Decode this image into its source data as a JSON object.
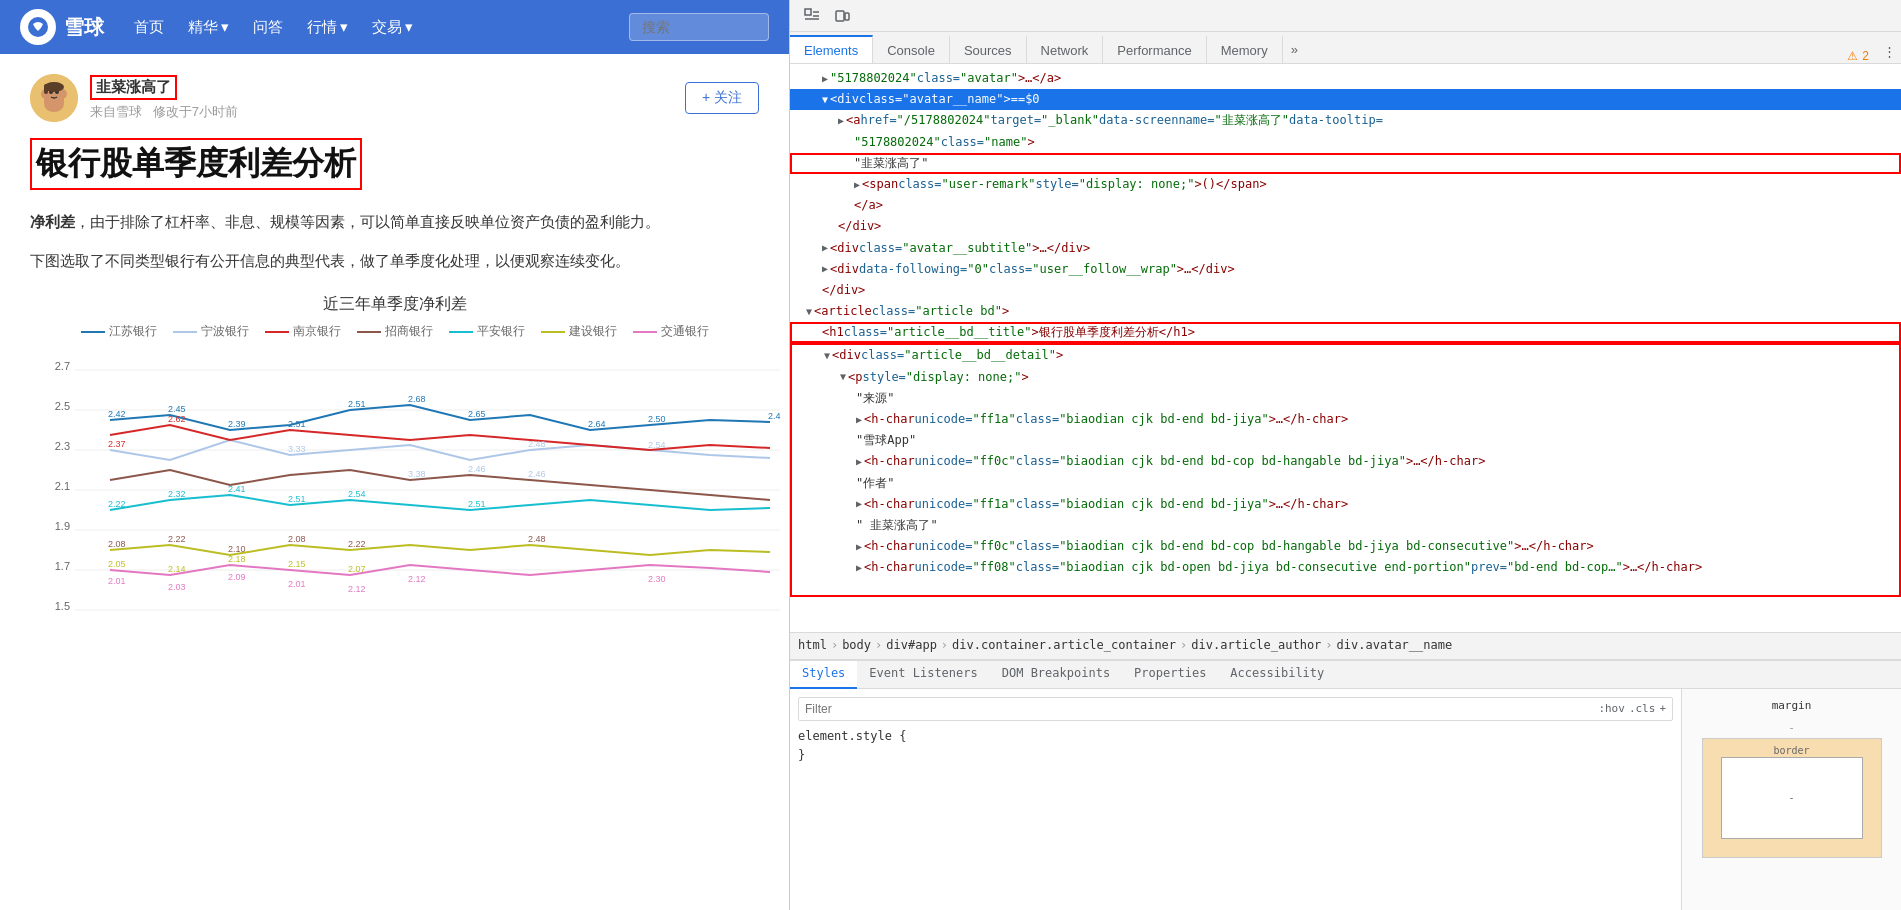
{
  "xueqiu": {
    "header": {
      "logo_text": "雪球",
      "nav_items": [
        "首页",
        "精华",
        "问答",
        "行情",
        "交易"
      ],
      "search_placeholder": "搜索",
      "nav_dropdown": [
        "精华",
        "行情",
        "交易"
      ]
    },
    "article": {
      "author_name": "韭菜涨高了",
      "author_source": "来自雪球",
      "author_time": "修改于7小时前",
      "follow_label": "+ 关注",
      "title": "银行股单季度利差分析",
      "body_p1_bold": "净利差",
      "body_p1_rest": "，由于排除了杠杆率、非息、规模等因素，可以简单直接反映单位资产负债的盈利能力。",
      "body_p2": "下图选取了不同类型银行有公开信息的典型代表，做了单季度化处理，以便观察连续变化。",
      "chart_title": "近三年单季度净利差",
      "chart_legend": [
        {
          "name": "江苏银行",
          "color": "#1f77b4"
        },
        {
          "name": "宁波银行",
          "color": "#aec7e8"
        },
        {
          "name": "南京银行",
          "color": "#d62728"
        },
        {
          "name": "招商银行",
          "color": "#8c564b"
        },
        {
          "name": "平安银行",
          "color": "#17becf"
        },
        {
          "name": "建设银行",
          "color": "#bcbd22"
        },
        {
          "name": "交通银行",
          "color": "#e377c2"
        }
      ]
    }
  },
  "devtools": {
    "toolbar_tabs": [
      "Elements",
      "Console",
      "Sources",
      "Network",
      "Performance",
      "Memory"
    ],
    "tab_active": "Elements",
    "tab_more": "»",
    "warning_count": "2",
    "breadcrumb": [
      "html",
      "body",
      "div#app",
      "div.container.article_container",
      "div.article_author",
      "div.avatar__name"
    ],
    "elements": [
      {
        "indent": 2,
        "content": "\"5178802024\" class=\"avatar\">…</a>",
        "type": "tag_line"
      },
      {
        "indent": 2,
        "content": "▼ <div class=\"avatar__name\"> == $0",
        "type": "tag_open",
        "selected": true
      },
      {
        "indent": 3,
        "content": "▶ <a href=\"/5178802024\" target=\"_blank\" data-screenname=\"韭菜涨高了\" data-tooltip=",
        "type": "tag"
      },
      {
        "indent": 4,
        "content": "\"5178802024\" class=\"name\">",
        "type": "text"
      },
      {
        "indent": 4,
        "content": "<span class=\"red-highlight\">\"韭菜涨高了\"</span>",
        "type": "highlighted"
      },
      {
        "indent": 4,
        "content": "<span class=\"user-remark\" style=\"display: none;\">()</span>",
        "type": "tag"
      },
      {
        "indent": 4,
        "content": "</a>",
        "type": "tag"
      },
      {
        "indent": 3,
        "content": "</div>",
        "type": "tag"
      },
      {
        "indent": 2,
        "content": "▶ <div class=\"avatar__subtitle\">…</div>",
        "type": "tag"
      },
      {
        "indent": 2,
        "content": "▶ <div data-following=\"0\" class=\"user__follow__wrap\">…</div>",
        "type": "tag"
      },
      {
        "indent": 2,
        "content": "</div>",
        "type": "tag"
      },
      {
        "indent": 1,
        "content": "▼ <article class=\"article bd\">",
        "type": "tag_open"
      },
      {
        "indent": 2,
        "content": "<h1 class=\"article__bd__title\">银行股单季度利差分析</h1>",
        "type": "h1_highlighted"
      },
      {
        "indent": 2,
        "content": "▼ <div class=\"article__bd__detail\">",
        "type": "tag_open",
        "box_highlight": true
      },
      {
        "indent": 3,
        "content": "▼ <p style=\"display: none;\">",
        "type": "tag_open"
      },
      {
        "indent": 4,
        "content": "\"来源\"",
        "type": "text"
      },
      {
        "indent": 4,
        "content": "▶ <h-char unicode=\"ff1a\" class=\"biaodian cjk bd-end bd-jiya\">…</h-char>",
        "type": "tag"
      },
      {
        "indent": 4,
        "content": "\"雪球App\"",
        "type": "text"
      },
      {
        "indent": 4,
        "content": "▶ <h-char unicode=\"ff0c\" class=\"biaodian cjk bd-end bd-cop bd-hangable bd-jiya\">…</h-char>",
        "type": "tag"
      },
      {
        "indent": 4,
        "content": "\"作者\"",
        "type": "text"
      },
      {
        "indent": 4,
        "content": "▶ <h-char unicode=\"ff1a\" class=\"biaodian cjk bd-end bd-jiya\">…</h-char>",
        "type": "tag"
      },
      {
        "indent": 4,
        "content": "\" 韭菜涨高了\"",
        "type": "text"
      },
      {
        "indent": 4,
        "content": "▶ <h-char unicode=\"ff0c\" class=\"biaodian cjk bd-end bd-cop bd-hangable bd-jiya bd-consecutive\">…</h-char>",
        "type": "tag"
      },
      {
        "indent": 4,
        "content": "▶ <h-char unicode=\"ff08\" class=\"biaodian cjk bd-open bd-jiya bd-consecutive end-portion\" prev=\"bd-end bd-cop…\">…</h-char>",
        "type": "tag"
      }
    ],
    "styles": {
      "filter_placeholder": "Filter",
      "filter_actions": [
        ":hov",
        ".cls",
        "+"
      ],
      "rules": [
        {
          "selector": "element.style {",
          "props": []
        },
        {
          "selector": "}",
          "props": []
        }
      ]
    },
    "styles_tabs": [
      "Styles",
      "Event Listeners",
      "DOM Breakpoints",
      "Properties",
      "Accessibility"
    ],
    "styles_tab_active": "Styles",
    "box_model": {
      "label": "-",
      "border_label": "-"
    }
  }
}
